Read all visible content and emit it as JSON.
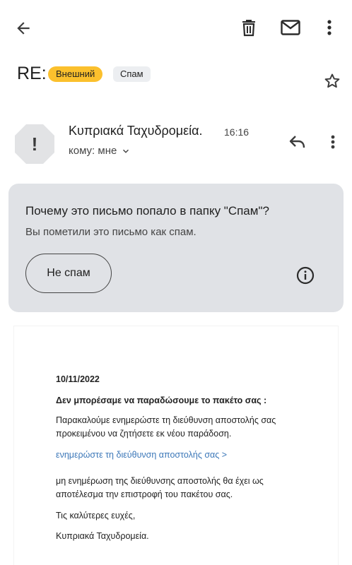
{
  "toolbar": {
    "back_icon": "arrow-back-icon",
    "delete_icon": "trash-icon",
    "mark_unread_icon": "mail-icon",
    "more_icon": "more-vertical-icon"
  },
  "subject": {
    "text": "RE:",
    "chips": [
      "Внешний",
      "Спам"
    ],
    "star_icon": "star-outline-icon"
  },
  "message": {
    "sender": "Κυπριακά Ταχυδρομεία.",
    "time": "16:16",
    "to": "кому: мне",
    "avatar_glyph": "!"
  },
  "spam_notice": {
    "title": "Почему это письмо попало в папку \"Спам\"?",
    "subtitle": "Вы пометили это письмо как спам.",
    "button": "Не спам"
  },
  "body": {
    "date": "10/11/2022",
    "heading": "Δεν μπορέσαμε να παραδώσουμε το πακέτο σας :",
    "para1": "Παρακαλούμε ενημερώστε τη διεύθυνση αποστολής σας προκειμένου να ζητήσετε εκ νέου παράδοση.",
    "link": "ενημερώστε τη διεύθυνση αποστολής σας >",
    "para2": "μη ενημέρωση της διεύθυνσης αποστολής θα έχει ως αποτέλεσμα την επιστροφή του πακέτου σας.",
    "greeting": "Τις καλύτερες ευχές,",
    "signature": "Κυπριακά Ταχυδρομεία."
  },
  "colors": {
    "external_chip": "#fbc02d",
    "spam_chip": "#eceef1",
    "spam_card": "#e0e2e6",
    "link": "#3b77b8"
  }
}
